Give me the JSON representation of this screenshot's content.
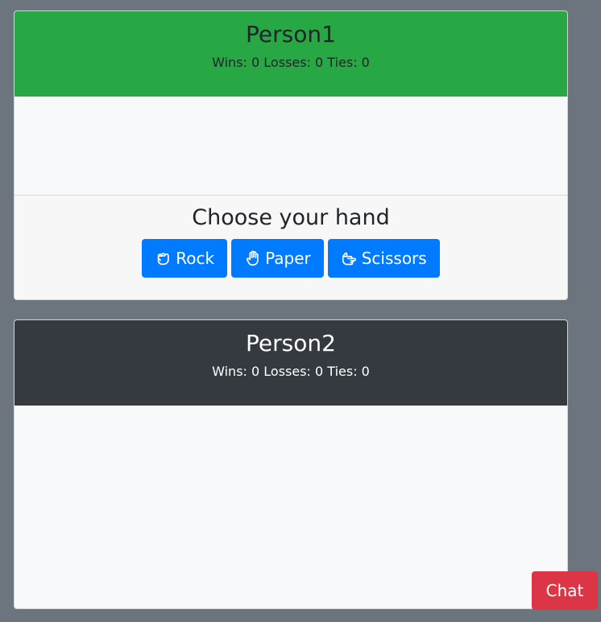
{
  "player1": {
    "name": "Person1",
    "record": "Wins: 0 Losses: 0 Ties: 0",
    "header_color": "#28a745"
  },
  "choose": {
    "title": "Choose your hand",
    "buttons": [
      {
        "label": "Rock",
        "icon": "hand-rock-icon"
      },
      {
        "label": "Paper",
        "icon": "hand-paper-icon"
      },
      {
        "label": "Scissors",
        "icon": "hand-scissors-icon"
      }
    ],
    "button_color": "#007bff"
  },
  "player2": {
    "name": "Person2",
    "record": "Wins: 0 Losses: 0 Ties: 0",
    "header_color": "#343a40"
  },
  "chat": {
    "label": "Chat",
    "color": "#dc3545"
  }
}
